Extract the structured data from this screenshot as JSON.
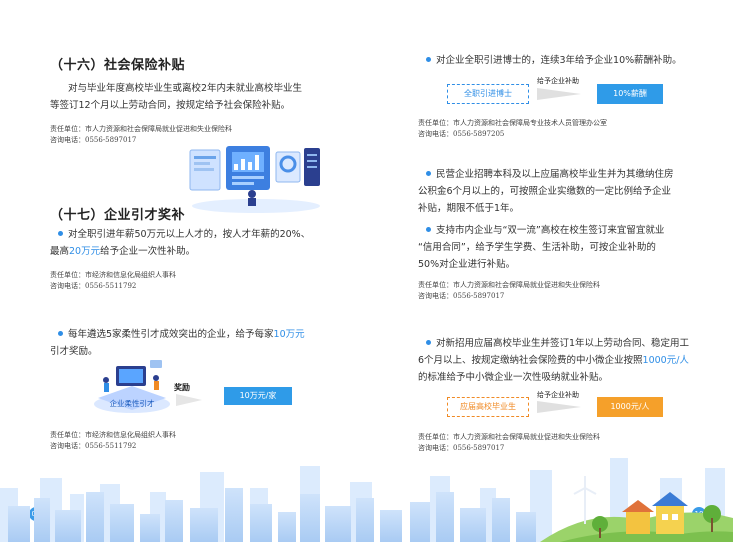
{
  "left": {
    "sec16": {
      "title": "（十六）社会保险补贴",
      "para_line1": "对与毕业年度高校毕业生或离校2年内未就业高校毕业生",
      "para_line2": "等签订12个月以上劳动合同，按规定给予社会保险补贴。",
      "dept": "责任单位：市人力资源和社会保障局就业促进和失业保险科",
      "phone": "咨询电话：0556-5897017"
    },
    "sec17": {
      "title": "（十七）企业引才奖补",
      "item1_a": "对全职引进年薪50万元以上人才的，按人才年薪的20%、",
      "item1_b_pre": "最高",
      "item1_b_hl": "20万元",
      "item1_b_post": "给予企业一次性补助。",
      "item1_dept": "责任单位：市经济和信息化局组织人事科",
      "item1_phone": "咨询电话：0556-5511792",
      "item2_a_pre": "每年遴选5家柔性引才成效突出的企业，给予每家",
      "item2_a_hl": "10万元",
      "item2_b": "引才奖励。",
      "diagram_label": "企业柔性引才",
      "diagram_arrow": "奖励",
      "diagram_result": "10万元/家",
      "item2_dept": "责任单位：市经济和信息化局组织人事科",
      "item2_phone": "咨询电话：0556-5511792"
    },
    "page_number": "09"
  },
  "right": {
    "item1": {
      "text": "对企业全职引进博士的，连续3年给予企业10%薪酬补助。",
      "box_label": "全职引进博士",
      "arrow_label": "给予企业补助",
      "result": "10%薪酬",
      "dept": "责任单位：市人力资源和社会保障局专业技术人员管理办公室",
      "phone": "咨询电话：0556-5897205"
    },
    "item2": {
      "line1": "民营企业招聘本科及以上应届高校毕业生并为其缴纳住房",
      "line2": "公积金6个月以上的，可按照企业实缴数的一定比例给予企业",
      "line3": "补贴，期限不低于1年。"
    },
    "item3": {
      "line1": "支持市内企业与“双一流”高校在校生签订来宜留宜就业",
      "line2": "“信用合同”，给予学生学费、生活补助，可按企业补助的",
      "line3": "50%对企业进行补贴。",
      "dept": "责任单位：市人力资源和社会保障局就业促进和失业保险科",
      "phone": "咨询电话：0556-5897017"
    },
    "item4": {
      "line1": "对新招用应届高校毕业生并签订1年以上劳动合同、稳定用工",
      "line2_pre": "6个月以上、按规定缴纳社会保险费的中小微企业按照",
      "line2_hl": "1000元/人",
      "line3": "的标准给予中小微企业一次性吸纳就业补贴。",
      "box_label": "应届高校毕业生",
      "arrow_label": "给予企业补助",
      "result": "1000元/人",
      "dept": "责任单位：市人力资源和社会保障局就业促进和失业保险科",
      "phone": "咨询电话：0556-5897017"
    },
    "page_number": "10"
  },
  "colors": {
    "accent_blue": "#2f8ee6",
    "accent_orange": "#f08a24",
    "box_blue": "#2f9be8",
    "box_orange": "#f5a02a"
  }
}
